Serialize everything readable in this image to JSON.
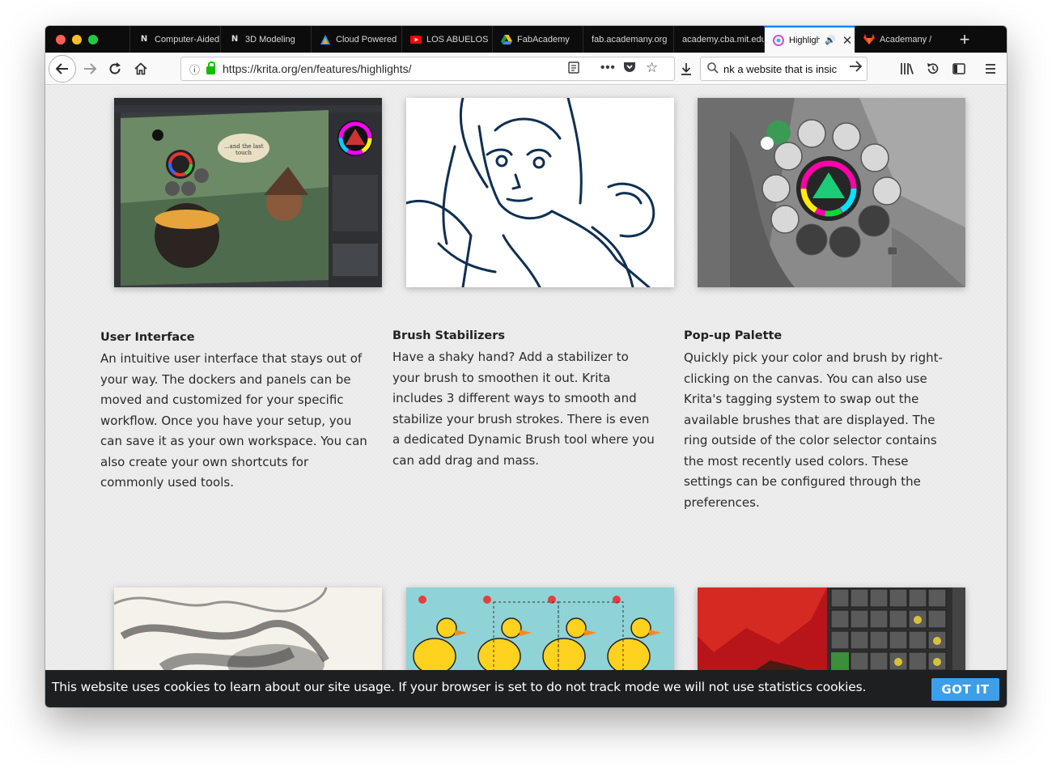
{
  "browser": {
    "tabs": [
      {
        "label": "Computer-Aided",
        "icon": "logo-icon"
      },
      {
        "label": "3D Modeling",
        "icon": "logo-icon"
      },
      {
        "label": "Cloud Powered",
        "icon": "triangle-icon"
      },
      {
        "label": "LOS ABUELOS",
        "icon": "youtube-icon"
      },
      {
        "label": "FabAcademy",
        "icon": "drive-icon"
      },
      {
        "label": "fab.academany.org",
        "icon": ""
      },
      {
        "label": "academy.cba.mit.edu",
        "icon": ""
      },
      {
        "label": "Highlights",
        "icon": "krita-icon"
      },
      {
        "label": "Academany /",
        "icon": "gitlab-icon"
      }
    ],
    "url": "https://krita.org/en/features/highlights/",
    "search_text": "nk a website that is insic"
  },
  "features": [
    {
      "title": "User Interface",
      "body": "An intuitive user interface that stays out of your way. The dockers and panels can be moved and customized for your specific workflow. Once you have your setup, you can save it as your own workspace. You can also create your own shortcuts for commonly used tools."
    },
    {
      "title": "Brush Stabilizers",
      "body": "Have a shaky hand? Add a stabilizer to your brush to smoothen it out. Krita includes 3 different ways to smooth and stabilize your brush strokes. There is even a dedicated Dynamic Brush tool where you can add drag and mass."
    },
    {
      "title": "Pop-up Palette",
      "body": "Quickly pick your color and brush by right-clicking on the canvas. You can also use Krita's tagging system to swap out the available brushes that are displayed. The ring outside of the color selector contains the most recently used colors. These settings can be configured through the preferences."
    }
  ],
  "cookie": {
    "message": "This website uses cookies to learn about our site usage. If your browser is set to do not track mode we will not use statistics cookies.",
    "button": "GOT IT"
  },
  "colors": {
    "accent": "#0a84ff",
    "cookie_button": "#3d9ee9",
    "cookie_bar": "#1d1f21"
  }
}
